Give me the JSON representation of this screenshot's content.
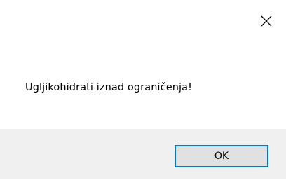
{
  "dialog": {
    "close_icon": "close-icon",
    "message": "Ugljikohidrati iznad ograničenja!",
    "ok_label": "OK"
  },
  "colors": {
    "background": "#ffffff",
    "footer": "#f0f0f0",
    "button_face": "#e1e1e1",
    "button_border_focus": "#0078d7",
    "text": "#000000"
  }
}
